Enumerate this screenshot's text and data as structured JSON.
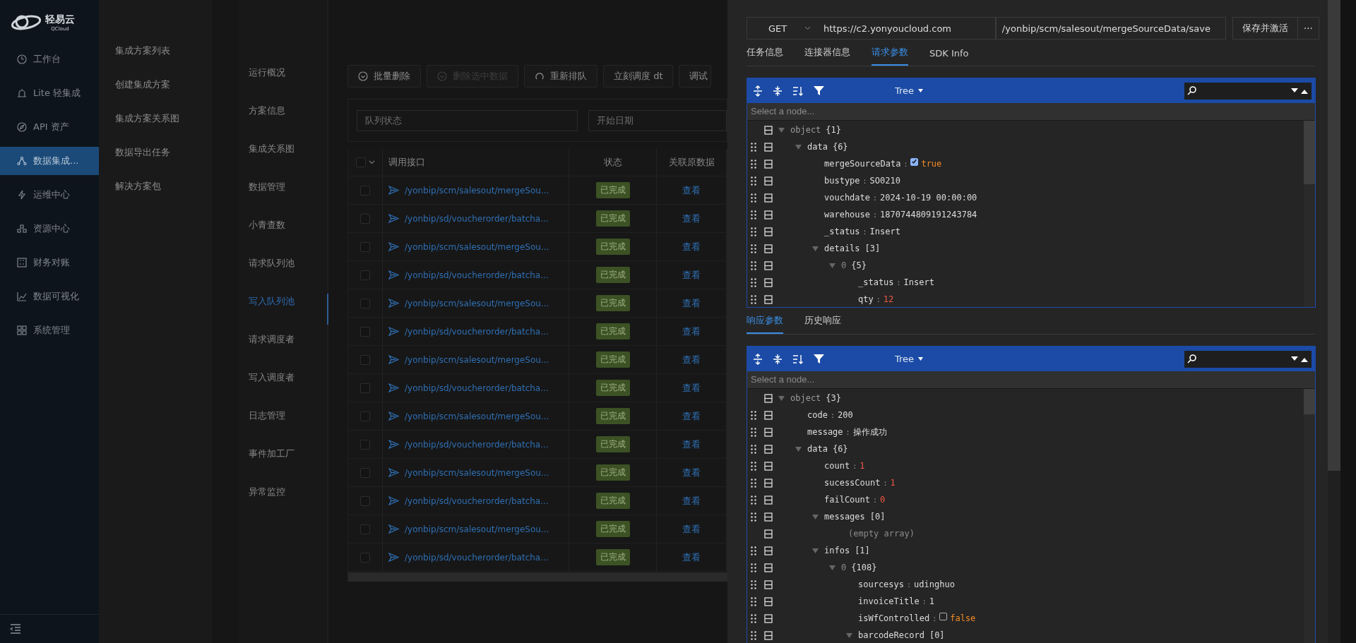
{
  "logo": {
    "name": "轻易云",
    "sub": "QCloud"
  },
  "nav": [
    {
      "label": "工作台",
      "selected": false
    },
    {
      "label": "Lite 轻集成",
      "selected": false
    },
    {
      "label": "API 资产",
      "selected": false
    },
    {
      "label": "数据集成...",
      "selected": true
    },
    {
      "label": "运维中心",
      "selected": false
    },
    {
      "label": "资源中心",
      "selected": false
    },
    {
      "label": "财务对账",
      "selected": false
    },
    {
      "label": "数据可视化",
      "selected": false
    },
    {
      "label": "系统管理",
      "selected": false
    }
  ],
  "submenu": [
    "集成方案列表",
    "创建集成方案",
    "集成方案关系图",
    "数据导出任务",
    "解决方案包"
  ],
  "side_tabs": [
    {
      "label": "运行概况",
      "selected": false
    },
    {
      "label": "方案信息",
      "selected": false
    },
    {
      "label": "集成关系图",
      "selected": false
    },
    {
      "label": "数据管理",
      "selected": false
    },
    {
      "label": "小青查数",
      "selected": false
    },
    {
      "label": "请求队列池",
      "selected": false
    },
    {
      "label": "写入队列池",
      "selected": true
    },
    {
      "label": "请求调度者",
      "selected": false
    },
    {
      "label": "写入调度者",
      "selected": false
    },
    {
      "label": "日志管理",
      "selected": false
    },
    {
      "label": "事件加工厂",
      "selected": false
    },
    {
      "label": "异常监控",
      "selected": false
    }
  ],
  "toolbar": [
    {
      "label": "批量删除",
      "kind": "check",
      "disabled": false
    },
    {
      "label": "删除选中数据",
      "kind": "check",
      "disabled": true
    },
    {
      "label": "重新排队",
      "kind": "refresh",
      "disabled": false
    },
    {
      "label": "立刻调度 dt",
      "kind": "plain",
      "disabled": false
    },
    {
      "label": "调试",
      "kind": "plain",
      "disabled": false
    }
  ],
  "filters": [
    {
      "placeholder": "队列状态"
    },
    {
      "placeholder": "开始日期"
    }
  ],
  "table": {
    "select_all_checked": false,
    "columns": [
      "调用接口",
      "状态",
      "关联原数据"
    ],
    "rows": [
      {
        "endpoint": "/yonbip/scm/salesout/mergeSou...",
        "status": "已完成",
        "link": "查看",
        "checked": false
      },
      {
        "endpoint": "/yonbip/sd/voucherorder/batcha...",
        "status": "已完成",
        "link": "查看",
        "checked": false
      },
      {
        "endpoint": "/yonbip/scm/salesout/mergeSou...",
        "status": "已完成",
        "link": "查看",
        "checked": false
      },
      {
        "endpoint": "/yonbip/sd/voucherorder/batcha...",
        "status": "已完成",
        "link": "查看",
        "checked": false
      },
      {
        "endpoint": "/yonbip/scm/salesout/mergeSou...",
        "status": "已完成",
        "link": "查看",
        "checked": false
      },
      {
        "endpoint": "/yonbip/sd/voucherorder/batcha...",
        "status": "已完成",
        "link": "查看",
        "checked": false
      },
      {
        "endpoint": "/yonbip/scm/salesout/mergeSou...",
        "status": "已完成",
        "link": "查看",
        "checked": false
      },
      {
        "endpoint": "/yonbip/sd/voucherorder/batcha...",
        "status": "已完成",
        "link": "查看",
        "checked": false
      },
      {
        "endpoint": "/yonbip/scm/salesout/mergeSou...",
        "status": "已完成",
        "link": "查看",
        "checked": false
      },
      {
        "endpoint": "/yonbip/sd/voucherorder/batcha...",
        "status": "已完成",
        "link": "查看",
        "checked": false
      },
      {
        "endpoint": "/yonbip/scm/salesout/mergeSou...",
        "status": "已完成",
        "link": "查看",
        "checked": false
      },
      {
        "endpoint": "/yonbip/sd/voucherorder/batcha...",
        "status": "已完成",
        "link": "查看",
        "checked": false
      },
      {
        "endpoint": "/yonbip/scm/salesout/mergeSou...",
        "status": "已完成",
        "link": "查看",
        "checked": false
      },
      {
        "endpoint": "/yonbip/sd/voucherorder/batcha...",
        "status": "已完成",
        "link": "查看",
        "checked": false
      }
    ]
  },
  "request": {
    "method": "GET",
    "base_url": "https://c2.yonyoucloud.com",
    "path": "/yonbip/scm/salesout/mergeSourceData/save",
    "save_button": "保存并激活",
    "more_button": "···"
  },
  "tabs": [
    {
      "label": "任务信息",
      "selected": false
    },
    {
      "label": "连接器信息",
      "selected": false
    },
    {
      "label": "请求参数",
      "selected": true
    },
    {
      "label": "SDK Info",
      "selected": false
    }
  ],
  "request_editor": {
    "mode": "Tree",
    "node_placeholder": "Select a node...",
    "separator": ":",
    "tree": {
      "kind": "object",
      "key": "object",
      "count": "{1}",
      "expanded": true,
      "children": [
        {
          "kind": "object",
          "key": "data",
          "count": "{6}",
          "expanded": true,
          "children": [
            {
              "kind": "boolean",
              "key": "mergeSourceData",
              "value": "true",
              "checked": true
            },
            {
              "kind": "string",
              "key": "bustype",
              "value": "SO0210"
            },
            {
              "kind": "string",
              "key": "vouchdate",
              "value": "2024-10-19 00:00:00"
            },
            {
              "kind": "string",
              "key": "warehouse",
              "value": "1870744809191243784"
            },
            {
              "kind": "string",
              "key": "_status",
              "value": "Insert"
            },
            {
              "kind": "object",
              "key": "details",
              "count": "[3]",
              "expanded": true,
              "children": [
                {
                  "kind": "element",
                  "key": "0",
                  "count": "{5}",
                  "expanded": true,
                  "children": [
                    {
                      "kind": "string",
                      "key": "_status",
                      "value": "Insert"
                    },
                    {
                      "kind": "number",
                      "key": "qty",
                      "value": "12"
                    }
                  ]
                }
              ]
            }
          ]
        }
      ]
    }
  },
  "response_tabs": [
    {
      "label": "响应参数",
      "selected": true
    },
    {
      "label": "历史响应",
      "selected": false
    }
  ],
  "response_editor": {
    "mode": "Tree",
    "node_placeholder": "Select a node...",
    "separator": ":",
    "tree": {
      "kind": "object",
      "key": "object",
      "count": "{3}",
      "expanded": true,
      "children": [
        {
          "kind": "string",
          "key": "code",
          "value": "200"
        },
        {
          "kind": "string",
          "key": "message",
          "value": "操作成功"
        },
        {
          "kind": "object",
          "key": "data",
          "count": "{6}",
          "expanded": true,
          "children": [
            {
              "kind": "number",
              "key": "count",
              "value": "1"
            },
            {
              "kind": "number",
              "key": "sucessCount",
              "value": "1"
            },
            {
              "kind": "number",
              "key": "failCount",
              "value": "0"
            },
            {
              "kind": "object",
              "key": "messages",
              "count": "[0]",
              "expanded": true,
              "children": [
                {
                  "kind": "note",
                  "text": "(empty array)"
                }
              ]
            },
            {
              "kind": "object",
              "key": "infos",
              "count": "[1]",
              "expanded": true,
              "children": [
                {
                  "kind": "element",
                  "key": "0",
                  "count": "{108}",
                  "expanded": true,
                  "children": [
                    {
                      "kind": "string",
                      "key": "sourcesys",
                      "value": "udinghuo"
                    },
                    {
                      "kind": "string",
                      "key": "invoiceTitle",
                      "value": "1"
                    },
                    {
                      "kind": "boolean",
                      "key": "isWfControlled",
                      "value": "false",
                      "checked": false
                    },
                    {
                      "kind": "object",
                      "key": "barcodeRecord",
                      "count": "[0]",
                      "expanded": true
                    }
                  ]
                }
              ]
            }
          ]
        }
      ]
    }
  }
}
